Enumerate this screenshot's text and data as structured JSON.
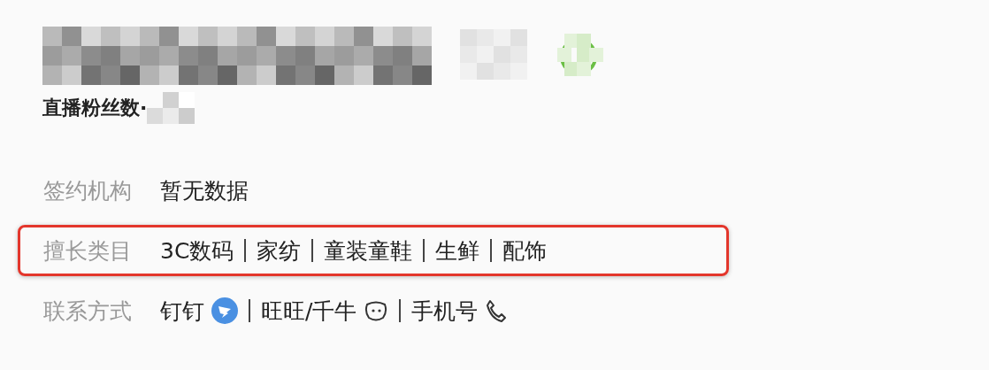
{
  "profile": {
    "fans_label": "直播粉丝数·"
  },
  "info_rows": [
    {
      "label": "签约机构",
      "kind": "text",
      "value": "暂无数据",
      "highlighted": false
    },
    {
      "label": "擅长类目",
      "kind": "categories",
      "items": [
        "3C数码",
        "家纺",
        "童装童鞋",
        "生鲜",
        "配饰"
      ],
      "highlighted": true
    },
    {
      "label": "联系方式",
      "kind": "contacts",
      "items": [
        {
          "label": "钉钉",
          "kind": "dingtalk"
        },
        {
          "label": "旺旺/千牛",
          "kind": "wangwang"
        },
        {
          "label": "手机号",
          "kind": "phone"
        }
      ],
      "highlighted": false
    }
  ]
}
